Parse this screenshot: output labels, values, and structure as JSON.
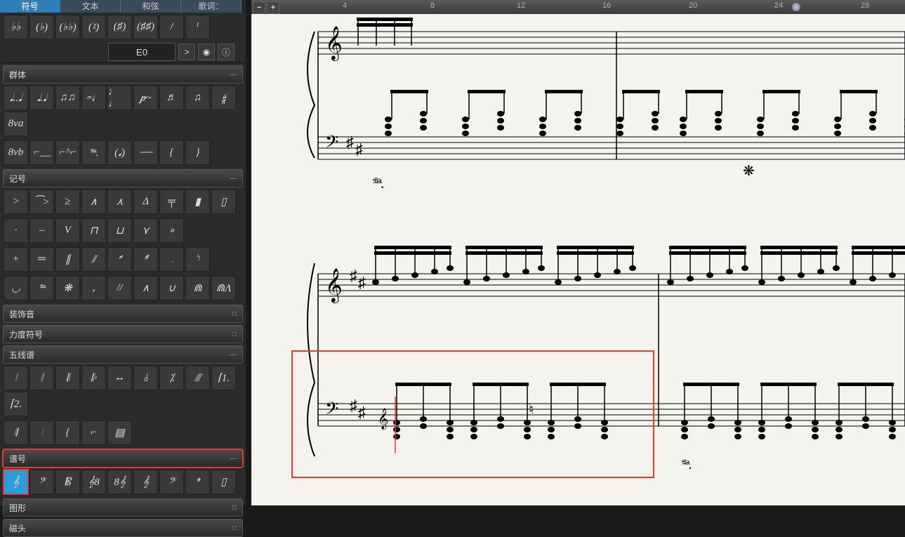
{
  "tabs": [
    {
      "label": "符号",
      "active": true
    },
    {
      "label": "文本",
      "active": false
    },
    {
      "label": "和弦",
      "active": false
    },
    {
      "label": "歌词：",
      "active": false
    }
  ],
  "note_input": {
    "value": "E0"
  },
  "icon_buttons": {
    "accent": ">",
    "midi": "◉",
    "info": "ⓘ"
  },
  "top_clef_row": [
    "♭♭",
    "(♭)",
    "(♭♭)",
    "(♮)",
    "(♯)",
    "(♯♯)",
    "/",
    "ᴵ"
  ],
  "sections": {
    "group": {
      "title": "群体",
      "collapse": "—",
      "rows": [
        [
          "𝅘𝅥..𝅘𝅥",
          "𝅘𝅥.𝅘𝅥",
          "♫♫",
          "𝄐♩",
          "♩ ♩",
          "𝆏~",
          "♬",
          "♫",
          "𝄱",
          "8va"
        ],
        [
          "8vb",
          "⌐__",
          "⌐^⌐",
          "𝆮.",
          "(𝅘𝅥)",
          "┄┄",
          "{",
          "}",
          ""
        ]
      ]
    },
    "marks": {
      "title": "记号",
      "collapse": "—",
      "rows": [
        [
          ">",
          "⁀>",
          "≥",
          "∧",
          "⋏",
          "Δ",
          "╤",
          "▮",
          "▯"
        ],
        [
          "·",
          "–",
          "V",
          "⊓",
          "⊔",
          "⋎",
          "∘",
          "",
          ""
        ],
        [
          "+",
          "═",
          "∥",
          "⫽",
          "𝅫",
          "𝅬",
          "𝅭",
          "𝅮",
          ""
        ],
        [
          "◡",
          "𝆮",
          "❋",
          ",",
          "//",
          "∧",
          "∪",
          "⋒",
          "⋒Λ"
        ]
      ]
    },
    "ornament": {
      "title": "装饰音",
      "collapse": "□"
    },
    "dynamics": {
      "title": "力度符号",
      "collapse": "□"
    },
    "staff": {
      "title": "五线谱",
      "collapse": "—",
      "rows": [
        [
          "𝄀",
          "𝄁",
          "𝄃",
          "𝄆",
          "↔",
          "⫰",
          "⁒",
          "⫻",
          "⌈1.",
          "⌈2."
        ],
        [
          "𝄂",
          "𝄄",
          "{",
          "⌐",
          "▤",
          "",
          "",
          "",
          "",
          ""
        ]
      ]
    },
    "clef": {
      "title": "谱号",
      "collapse": "—",
      "highlight": true,
      "rows": [
        [
          "𝄞",
          "𝄢",
          "𝄡",
          "𝄞8",
          "8𝄞",
          "𝄞",
          "𝄢",
          "𝄌",
          "▯"
        ]
      ],
      "selected": 0
    },
    "graphic": {
      "title": "图形",
      "collapse": "□"
    },
    "head": {
      "title": "磁头",
      "collapse": "□"
    }
  },
  "ruler": {
    "numbers": [
      "4",
      "8",
      "12",
      "16",
      "20",
      "24",
      "28"
    ],
    "handle_pos": 24.5
  },
  "score_text": {
    "pedal": "𝆮."
  }
}
